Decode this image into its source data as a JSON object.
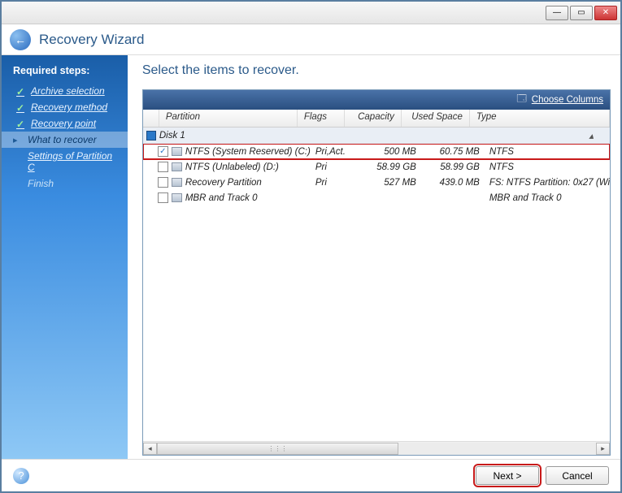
{
  "window": {
    "title": "Recovery Wizard",
    "minimize": "—",
    "maximize": "▭",
    "close": "✕"
  },
  "sidebar": {
    "heading": "Required steps:",
    "items": [
      {
        "label": "Archive selection",
        "state": "done"
      },
      {
        "label": "Recovery method",
        "state": "done"
      },
      {
        "label": "Recovery point",
        "state": "done"
      },
      {
        "label": "What to recover",
        "state": "current"
      },
      {
        "label": "Settings of Partition C",
        "state": "pending"
      },
      {
        "label": "Finish",
        "state": "dim"
      }
    ]
  },
  "main": {
    "heading": "Select the items to recover.",
    "choose_columns": "Choose Columns",
    "columns": {
      "partition": "Partition",
      "flags": "Flags",
      "capacity": "Capacity",
      "used": "Used Space",
      "type": "Type"
    },
    "disk_label": "Disk 1",
    "rows": [
      {
        "checked": true,
        "name": "NTFS (System Reserved) (C:)",
        "flags": "Pri,Act.",
        "capacity": "500 MB",
        "used": "60.75 MB",
        "type": "NTFS",
        "highlight": true
      },
      {
        "checked": false,
        "name": "NTFS (Unlabeled) (D:)",
        "flags": "Pri",
        "capacity": "58.99 GB",
        "used": "58.99 GB",
        "type": "NTFS"
      },
      {
        "checked": false,
        "name": "Recovery Partition",
        "flags": "Pri",
        "capacity": "527 MB",
        "used": "439.0 MB",
        "type": "FS: NTFS Partition: 0x27 (Wi"
      },
      {
        "checked": false,
        "name": "MBR and Track 0",
        "flags": "",
        "capacity": "",
        "used": "",
        "type": "MBR and Track 0"
      }
    ]
  },
  "footer": {
    "next": "Next >",
    "cancel": "Cancel"
  }
}
